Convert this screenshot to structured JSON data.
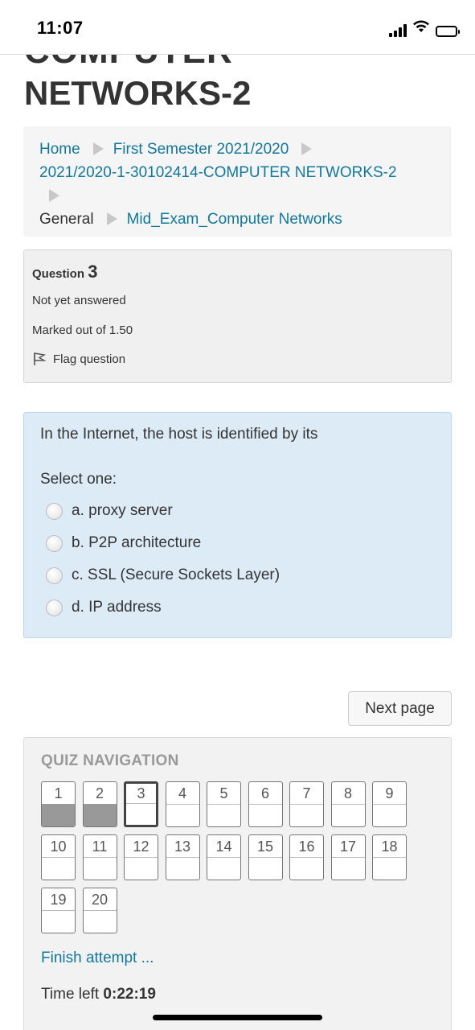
{
  "status_bar": {
    "time": "11:07"
  },
  "heading": {
    "cut_line": "COMPUTER",
    "title": "NETWORKS-2"
  },
  "breadcrumb": {
    "home": "Home",
    "semester": "First Semester 2021/2020",
    "course": "2021/2020-1-30102414-COMPUTER NETWORKS-2",
    "section": "General",
    "quiz": "Mid_Exam_Computer Networks"
  },
  "question_info": {
    "label": "Question",
    "number": "3",
    "state": "Not yet answered",
    "grade": "Marked out of 1.50",
    "flag": "Flag question"
  },
  "question": {
    "text": "In the Internet, the host is identified by its",
    "prompt": "Select one:",
    "options": [
      {
        "label": "a. proxy server"
      },
      {
        "label": "b. P2P architecture"
      },
      {
        "label": "c. SSL (Secure Sockets Layer)"
      },
      {
        "label": "d. IP address"
      }
    ]
  },
  "next_page": "Next page",
  "quiz_navigation": {
    "title": "QUIZ NAVIGATION",
    "questions": [
      {
        "n": "1",
        "state": "answered"
      },
      {
        "n": "2",
        "state": "answered"
      },
      {
        "n": "3",
        "state": "current"
      },
      {
        "n": "4",
        "state": "unanswered"
      },
      {
        "n": "5",
        "state": "unanswered"
      },
      {
        "n": "6",
        "state": "unanswered"
      },
      {
        "n": "7",
        "state": "unanswered"
      },
      {
        "n": "8",
        "state": "unanswered"
      },
      {
        "n": "9",
        "state": "unanswered"
      },
      {
        "n": "10",
        "state": "unanswered"
      },
      {
        "n": "11",
        "state": "unanswered"
      },
      {
        "n": "12",
        "state": "unanswered"
      },
      {
        "n": "13",
        "state": "unanswered"
      },
      {
        "n": "14",
        "state": "unanswered"
      },
      {
        "n": "15",
        "state": "unanswered"
      },
      {
        "n": "16",
        "state": "unanswered"
      },
      {
        "n": "17",
        "state": "unanswered"
      },
      {
        "n": "18",
        "state": "unanswered"
      },
      {
        "n": "19",
        "state": "unanswered"
      },
      {
        "n": "20",
        "state": "unanswered"
      }
    ],
    "finish": "Finish attempt ...",
    "time_label": "Time left",
    "time_value": "0:22:19"
  },
  "colors": {
    "link": "#12789a",
    "question_bg": "#dcebf6",
    "answered_fill": "#999999"
  }
}
